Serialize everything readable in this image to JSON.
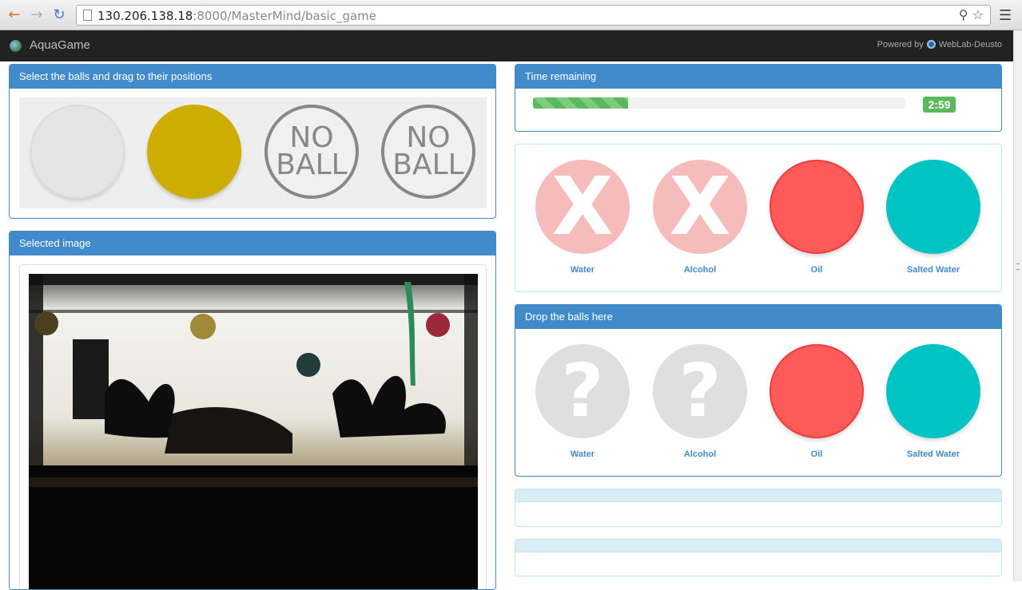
{
  "browser": {
    "url_host": "130.206.138.18",
    "url_rest": ":8000/MasterMind/basic_game"
  },
  "navbar": {
    "brand": "AquaGame",
    "powered_by": "Powered by",
    "powered_name": "WebLab-Deusto"
  },
  "selection_panel": {
    "title": "Select the balls and drag to their positions",
    "balls": [
      {
        "kind": "empty"
      },
      {
        "kind": "yellow",
        "color": "#ccad00"
      },
      {
        "kind": "no-ball",
        "line1": "NO",
        "line2": "BALL"
      },
      {
        "kind": "no-ball",
        "line1": "NO",
        "line2": "BALL"
      }
    ]
  },
  "image_panel": {
    "title": "Selected image"
  },
  "timer_panel": {
    "title": "Time remaining",
    "progress_fraction": 0.255,
    "time": "2:59"
  },
  "results_panel": {
    "items": [
      {
        "label": "Water",
        "state": "wrong",
        "glyph": "X"
      },
      {
        "label": "Alcohol",
        "state": "wrong",
        "glyph": "X"
      },
      {
        "label": "Oil",
        "state": "correct",
        "color": "#ff5a5a"
      },
      {
        "label": "Salted Water",
        "state": "correct",
        "color": "#00c4c4"
      }
    ]
  },
  "drop_panel": {
    "title": "Drop the balls here",
    "items": [
      {
        "label": "Water",
        "state": "unknown",
        "glyph": "?"
      },
      {
        "label": "Alcohol",
        "state": "unknown",
        "glyph": "?"
      },
      {
        "label": "Oil",
        "state": "filled",
        "color": "#ff5a5a"
      },
      {
        "label": "Salted Water",
        "state": "filled",
        "color": "#00c4c4"
      }
    ]
  }
}
